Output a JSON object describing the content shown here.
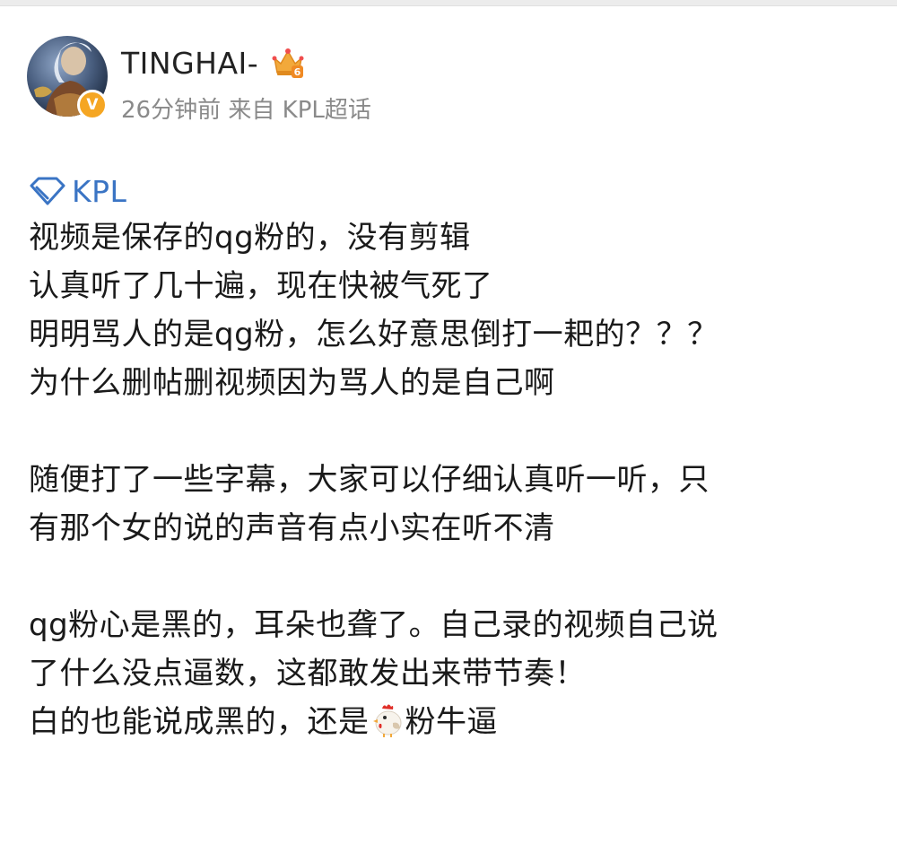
{
  "post": {
    "author": {
      "username": "TINGHAI-",
      "verified_badge_symbol": "V",
      "level_badge": "6"
    },
    "meta": {
      "time": "26分钟前",
      "source_prefix": "来自",
      "source": "KPL超话"
    },
    "topic": {
      "icon": "diamond-icon",
      "label": "KPL"
    },
    "paragraphs": [
      {
        "lines": [
          "视频是保存的qg粉的，没有剪辑",
          "认真听了几十遍，现在快被气死了",
          "明明骂人的是qg粉，怎么好意思倒打一耙的？？？",
          "为什么删帖删视频因为骂人的是自己啊"
        ]
      },
      {
        "lines": [
          "随便打了一些字幕，大家可以仔细认真听一听，只",
          "有那个女的说的声音有点小实在听不清"
        ]
      },
      {
        "lines": [
          "qg粉心是黑的，耳朵也聋了。自己录的视频自己说",
          "了什么没点逼数，这都敢发出来带节奏！"
        ],
        "last_line": {
          "before_emoji": "白的也能说成黑的，还是",
          "emoji": "chicken-emoji",
          "after_emoji": "粉牛逼"
        }
      }
    ]
  },
  "colors": {
    "link": "#3a74c4",
    "meta": "#8a8a8a",
    "text": "#1a1a1a",
    "verify_badge": "#f5a623"
  }
}
